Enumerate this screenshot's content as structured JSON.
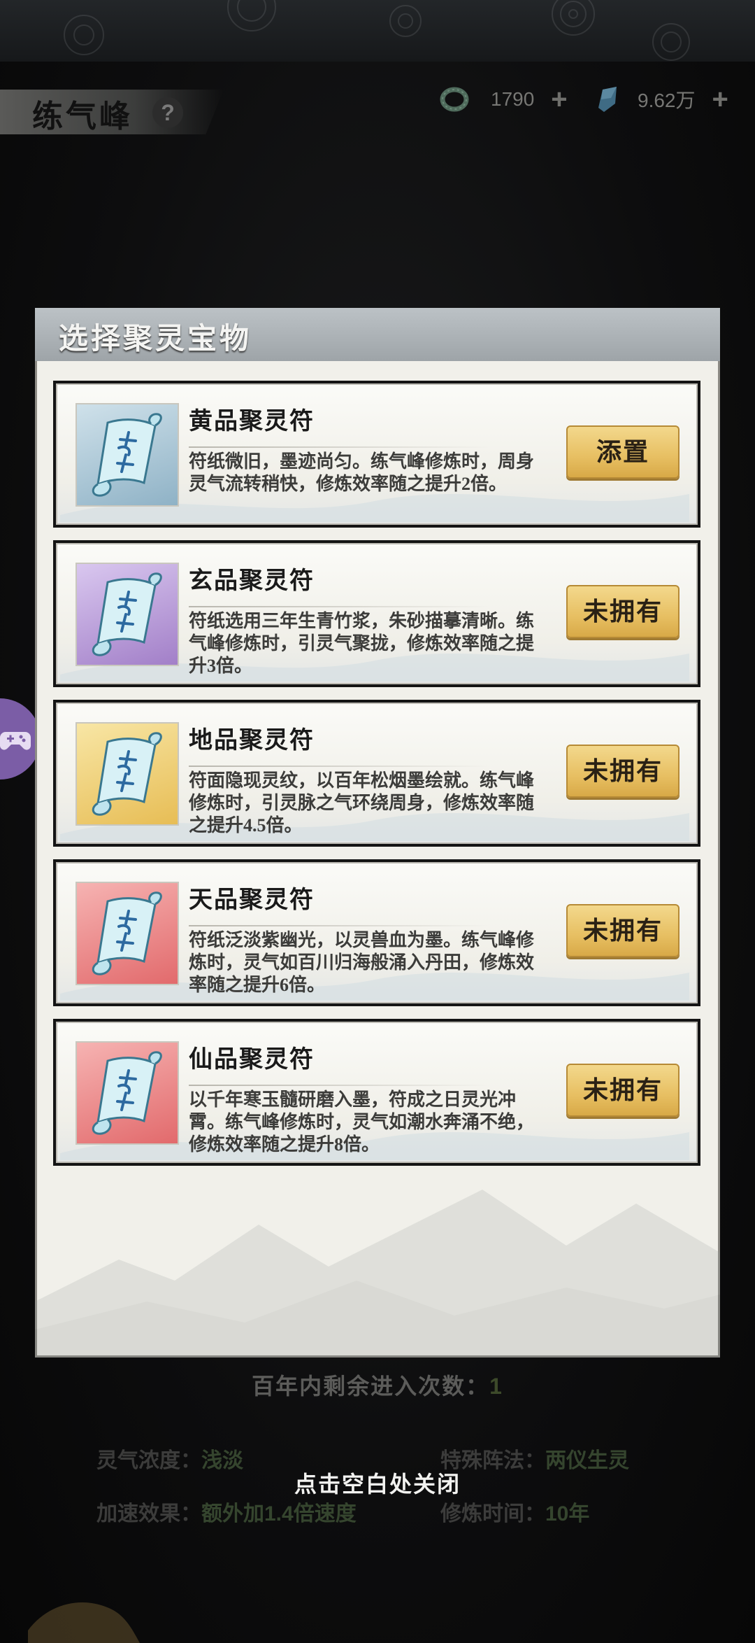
{
  "header": {
    "title": "练气峰",
    "help_icon": "question-icon",
    "resources": [
      {
        "icon": "jade-ring-icon",
        "value": "1790",
        "color": "#4f6b5c"
      },
      {
        "icon": "spirit-stone-icon",
        "value": "9.62万",
        "color": "#3f6b84"
      }
    ]
  },
  "panel": {
    "title": "选择聚灵宝物",
    "items": [
      {
        "name": "黄品聚灵符",
        "desc": "符纸微旧，墨迹尚匀。练气峰修炼时，周身灵气流转稍快，修炼效率随之提升2倍。",
        "button": "添置",
        "thumb_color": "#8fb2c6",
        "thumb_color2": "#cfe1ea"
      },
      {
        "name": "玄品聚灵符",
        "desc": "符纸选用三年生青竹浆，朱砂描摹清晰。练气峰修炼时，引灵气聚拢，修炼效率随之提升3倍。",
        "button": "未拥有",
        "thumb_color": "#a27fc8",
        "thumb_color2": "#d9c7ef"
      },
      {
        "name": "地品聚灵符",
        "desc": "符面隐现灵纹，以百年松烟墨绘就。练气峰修炼时，引灵脉之气环绕周身，修炼效率随之提升4.5倍。",
        "button": "未拥有",
        "thumb_color": "#e7bd55",
        "thumb_color2": "#f8e6a5"
      },
      {
        "name": "天品聚灵符",
        "desc": "符纸泛淡紫幽光，以灵兽血为墨。练气峰修炼时，灵气如百川归海般涌入丹田，修炼效率随之提升6倍。",
        "button": "未拥有",
        "thumb_color": "#e26a6c",
        "thumb_color2": "#f6b3b2"
      },
      {
        "name": "仙品聚灵符",
        "desc": "以千年寒玉髓研磨入墨，符成之日灵光冲霄。练气峰修炼时，灵气如潮水奔涌不绝，修炼效率随之提升8倍。",
        "button": "未拥有",
        "thumb_color": "#e26a6c",
        "thumb_color2": "#f6b3b2"
      }
    ]
  },
  "footer": {
    "entries_label": "百年内剩余进入次数：",
    "entries_value": "1",
    "stats": [
      {
        "label": "灵气浓度：",
        "value": "浅淡"
      },
      {
        "label": "特殊阵法：",
        "value": "两仪生灵"
      },
      {
        "label": "加速效果：",
        "value": "额外加1.4倍速度"
      },
      {
        "label": "修炼时间：",
        "value": "10年"
      }
    ],
    "close_hint": "点击空白处关闭"
  },
  "side_button": {
    "icon": "gamepad-icon",
    "color": "#7b5da6"
  }
}
